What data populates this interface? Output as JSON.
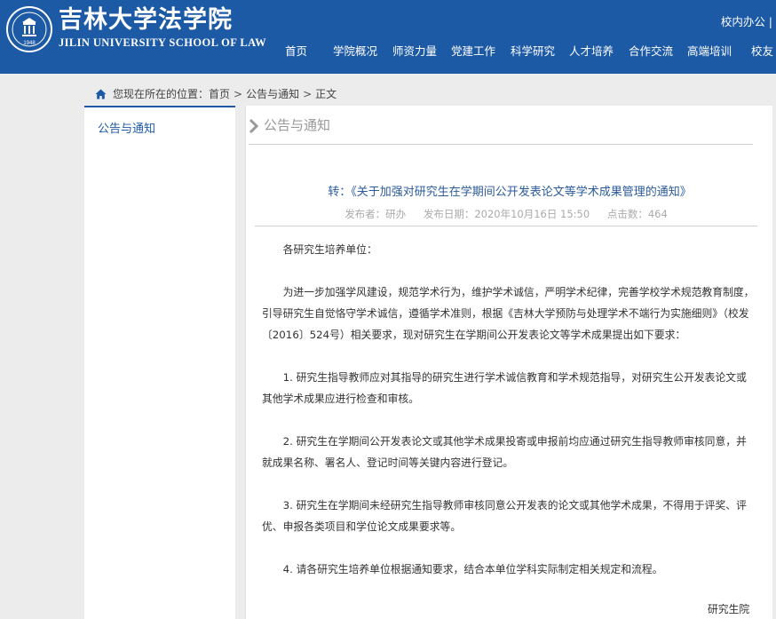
{
  "header": {
    "logo_cn": "吉林大学法学院",
    "logo_en": "JILIN UNIVERSITY SCHOOL OF LAW",
    "seal_year": "1948",
    "top_link": "校内办公 |",
    "brand_color": "#1d5aa6"
  },
  "nav": {
    "items": [
      "首页",
      "学院概况",
      "师资力量",
      "党建工作",
      "科学研究",
      "人才培养",
      "合作交流",
      "高端培训",
      "校友"
    ]
  },
  "breadcrumb": {
    "prefix": "您现在所在的位置：",
    "home": "首页",
    "section": "公告与通知",
    "current": "正文",
    "sep": ">"
  },
  "sidebar": {
    "items": [
      "公告与通知"
    ]
  },
  "article": {
    "section_title": "公告与通知",
    "title": "转：《关于加强对研究生在学期间公开发表论文等学术成果管理的通知》",
    "publisher": "发布者：研办",
    "date": "发布日期：2020年10月16日 15:50",
    "clicks": "点击数：464",
    "paragraphs": [
      "各研究生培养单位：",
      "为进一步加强学风建设，规范学术行为，维护学术诚信，严明学术纪律，完善学校学术规范教育制度，引导研究生自觉恪守学术诚信，遵循学术准则，根据《吉林大学预防与处理学术不端行为实施细则》（校发〔2016〕524号）相关要求，现对研究生在学期间公开发表论文等学术成果提出如下要求：",
      "1. 研究生指导教师应对其指导的研究生进行学术诚信教育和学术规范指导，对研究生公开发表论文或其他学术成果应进行检查和审核。",
      "2. 研究生在学期间公开发表论文或其他学术成果投寄或申报前均应通过研究生指导教师审核同意，并就成果名称、署名人、登记时间等关键内容进行登记。",
      "3. 研究生在学期间未经研究生指导教师审核同意公开发表的论文或其他学术成果，不得用于评奖、评优、申报各类项目和学位论文成果要求等。",
      "4. 请各研究生培养单位根据通知要求，结合本单位学科实际制定相关规定和流程。"
    ],
    "signature": "研究生院"
  }
}
